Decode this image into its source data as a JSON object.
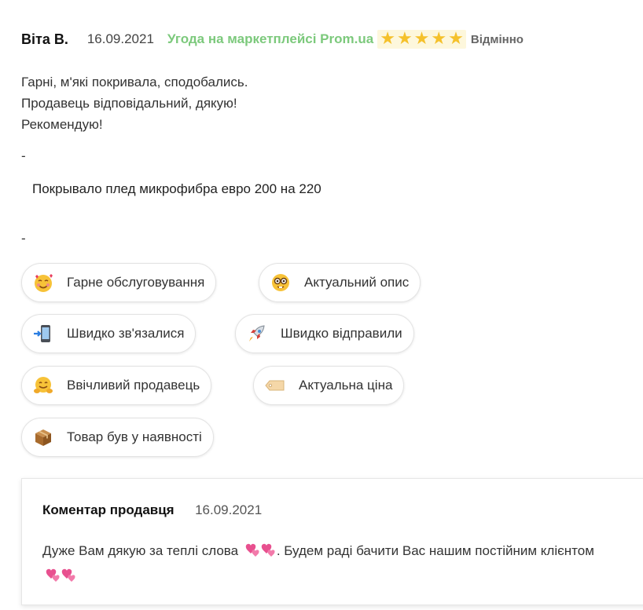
{
  "review": {
    "author": "Віта В.",
    "date": "16.09.2021",
    "deal_label": "Угода на маркетплейсі Prom.ua",
    "stars": 5,
    "rating_label": "Відмінно",
    "text_lines": [
      "Гарні, м'які покривала, сподобались.",
      "Продавець відповідальний, дякую!",
      "Рекомендую!"
    ],
    "dash_top": "-",
    "product": "Покрывало плед микрофибра евро 200 на 220",
    "dash_bottom": "-"
  },
  "tags": [
    {
      "label": "Гарне обслуговування",
      "icon": "smiling-face-with-hearts-icon"
    },
    {
      "label": "Актуальний опис",
      "icon": "nerd-face-icon"
    },
    {
      "label": "Швидко зв'язалися",
      "icon": "mobile-phone-arrow-icon"
    },
    {
      "label": "Швидко відправили",
      "icon": "rocket-icon"
    },
    {
      "label": "Ввічливий продавець",
      "icon": "hugging-face-icon"
    },
    {
      "label": "Актуальна ціна",
      "icon": "price-tag-icon"
    },
    {
      "label": "Товар був у наявності",
      "icon": "package-icon"
    }
  ],
  "seller_comment": {
    "title": "Коментар продавця",
    "date": "16.09.2021",
    "text_part1": "Дуже Вам дякую за теплі слова",
    "text_part2": ". Будем раді бачити Вас нашим постійним клієнтом"
  },
  "colors": {
    "deal_green": "#7cc97c",
    "star_yellow": "#f5c12b",
    "heart_pink": "#e8508f"
  }
}
